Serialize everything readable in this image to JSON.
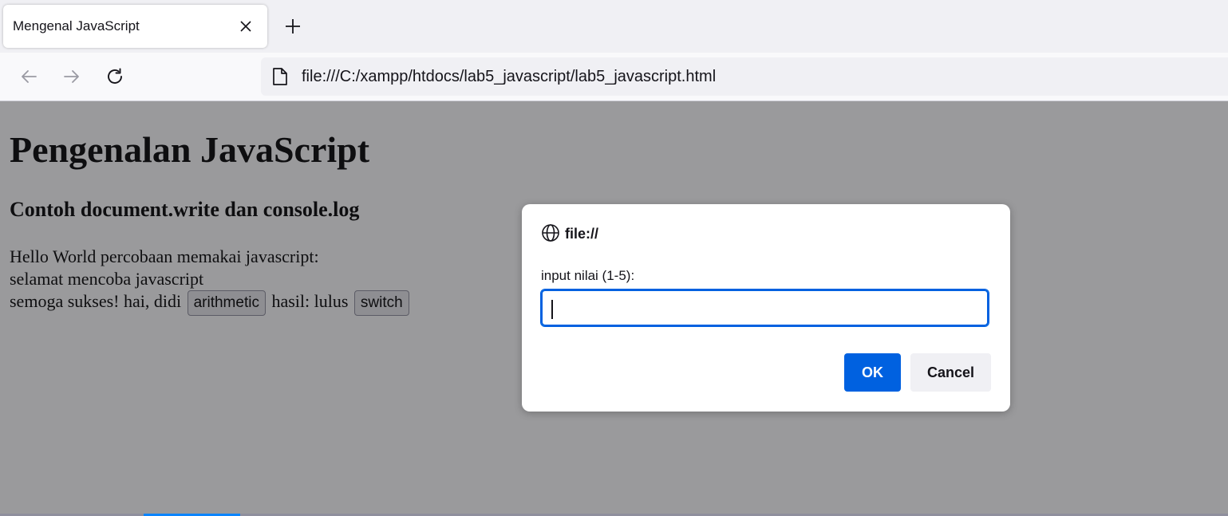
{
  "browser": {
    "tab": {
      "title": "Mengenal JavaScript"
    },
    "url": "file:///C:/xampp/htdocs/lab5_javascript/lab5_javascript.html"
  },
  "page": {
    "heading": "Pengenalan JavaScript",
    "subheading": "Contoh document.write dan console.log",
    "line1": "Hello World percobaan memakai javascript:",
    "line2": "selamat mencoba javascript",
    "line3_part1": "semoga sukses! hai, didi",
    "button_arithmetic": "arithmetic",
    "line3_part2": "hasil: lulus",
    "button_switch": "switch"
  },
  "dialog": {
    "origin": "file://",
    "message": "input nilai (1-5):",
    "input_value": "",
    "ok_label": "OK",
    "cancel_label": "Cancel"
  },
  "icons": {
    "tab_close": "close-icon",
    "new_tab": "plus-icon",
    "back": "arrow-left-icon",
    "forward": "arrow-right-icon",
    "reload": "reload-icon",
    "page": "page-icon",
    "origin": "globe-icon"
  },
  "colors": {
    "accent": "#0061e0",
    "overlay": "rgba(32,32,36,0.45)"
  }
}
